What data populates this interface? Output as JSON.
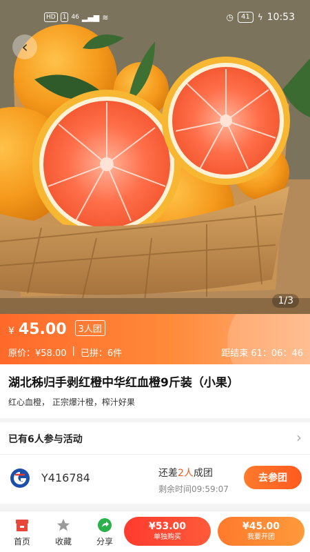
{
  "status_bar": {
    "left_chips": [
      "HD",
      "1",
      "46"
    ],
    "battery": "41",
    "time": "10:53"
  },
  "gallery": {
    "counter": "1/3"
  },
  "price": {
    "currency_symbol": "¥",
    "group_price": "45.00",
    "group_size_tag": "3人团",
    "original_price": "原价：¥58.00",
    "separator": "|",
    "sold_count": "已拼：6件",
    "countdown": "距结束 61：06：46"
  },
  "product": {
    "title": "湖北秭归手剥红橙中华红血橙9斤装（小果）",
    "subtitle": "红心血橙， 正宗爆汁橙，榨汁好果"
  },
  "group_activity": {
    "header": "已有6人参与活动",
    "member": {
      "user_id": "Y416784",
      "need_prefix": "还差",
      "need_count": "2人",
      "need_suffix": "成团",
      "remaining_time": "剩余时间09:59:07",
      "join_label": "去参团"
    }
  },
  "bottom_bar": {
    "tabs": [
      {
        "label": "首页",
        "icon": "shop-icon"
      },
      {
        "label": "收藏",
        "icon": "star-icon"
      },
      {
        "label": "分享",
        "icon": "share-icon"
      }
    ],
    "solo_buy": {
      "price": "¥53.00",
      "label": "单独购买"
    },
    "group_buy": {
      "price": "¥45.00",
      "label": "我要开团"
    }
  },
  "colors": {
    "accent": "#ff6a2a",
    "red_button": "#ff3b2f",
    "orange_button": "#ff7a2c",
    "share_green": "#2bb14a"
  }
}
